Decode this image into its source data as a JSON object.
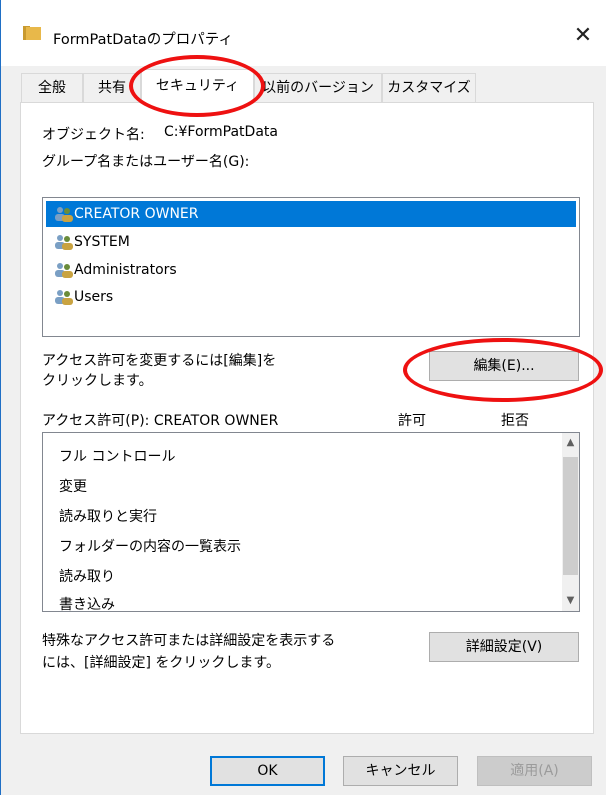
{
  "window": {
    "title": "FormPatDataのプロパティ",
    "close_symbol": "✕"
  },
  "tabs": [
    {
      "label": "全般",
      "active": false
    },
    {
      "label": "共有",
      "active": false
    },
    {
      "label": "セキュリティ",
      "active": true
    },
    {
      "label": "以前のバージョン",
      "active": false
    },
    {
      "label": "カスタマイズ",
      "active": false
    }
  ],
  "object": {
    "label": "オブジェクト名:",
    "value": "C:¥FormPatData"
  },
  "groups": {
    "label": "グループ名またはユーザー名(G):",
    "items": [
      {
        "label": "CREATOR OWNER",
        "selected": true,
        "icon": "users-group-icon"
      },
      {
        "label": "SYSTEM",
        "selected": false,
        "icon": "users-group-icon"
      },
      {
        "label": "Administrators",
        "selected": false,
        "icon": "users-group-icon"
      },
      {
        "label": "Users",
        "selected": false,
        "icon": "users-group-icon"
      }
    ]
  },
  "edit": {
    "hint_line1": "アクセス許可を変更するには[編集]を",
    "hint_line2": "クリックします。",
    "button_label": "編集(E)..."
  },
  "permissions": {
    "header_label": "アクセス許可(P): CREATOR OWNER",
    "allow_label": "許可",
    "deny_label": "拒否",
    "items": [
      "フル コントロール",
      "変更",
      "読み取りと実行",
      "フォルダーの内容の一覧表示",
      "読み取り",
      "書き込み"
    ]
  },
  "advanced": {
    "hint_line1": "特殊なアクセス許可または詳細設定を表示する",
    "hint_line2": "には、[詳細設定] をクリックします。",
    "button_label": "詳細設定(V)"
  },
  "footer": {
    "ok_label": "OK",
    "cancel_label": "キャンセル",
    "apply_label": "適用(A)"
  },
  "colors": {
    "selection": "#0078d7",
    "annotation": "#ee1111",
    "folder": "#e8b84a"
  }
}
